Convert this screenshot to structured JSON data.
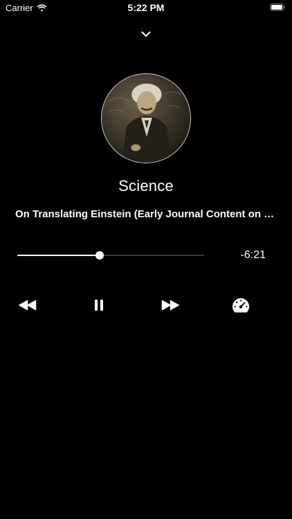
{
  "status_bar": {
    "carrier": "Carrier",
    "time": "5:22 PM"
  },
  "player": {
    "podcast_title": "Science",
    "episode_title": "On Translating Einstein (Early Journal Content on JSTOR)",
    "time_remaining": "-6:21",
    "progress": 0.44
  },
  "icons": {
    "collapse": "chevron-down-icon",
    "rewind": "rewind-icon",
    "pause": "pause-icon",
    "forward": "fast-forward-icon",
    "speed": "speedometer-icon"
  },
  "colors": {
    "background": "#000000",
    "foreground": "#ffffff",
    "track": "#3a3a3c"
  }
}
